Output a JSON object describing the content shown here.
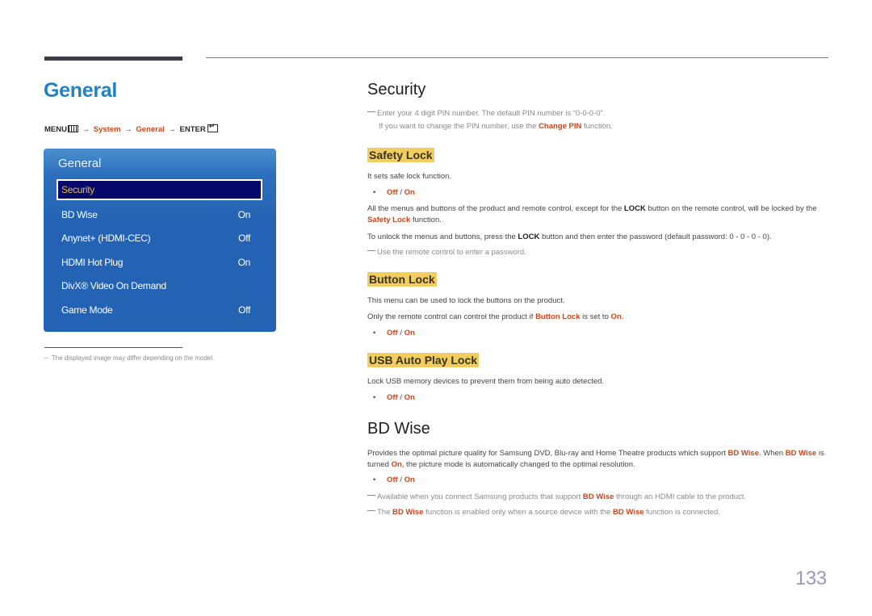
{
  "left": {
    "title": "General",
    "breadcrumb": {
      "menu": "MENU",
      "arrow": "→",
      "system": "System",
      "general": "General",
      "enter": "ENTER"
    },
    "osd": {
      "title": "General",
      "items": [
        {
          "label": "Security",
          "value": "",
          "selected": true
        },
        {
          "label": "BD Wise",
          "value": "On"
        },
        {
          "label": "Anynet+ (HDMI-CEC)",
          "value": "Off"
        },
        {
          "label": "HDMI Hot Plug",
          "value": "On"
        },
        {
          "label": "DivX® Video On Demand",
          "value": ""
        },
        {
          "label": "Game Mode",
          "value": "Off"
        }
      ]
    },
    "footnote": "The displayed image may differ depending on the model."
  },
  "security": {
    "title": "Security",
    "note1": "Enter your 4 digit PIN number. The default PIN number is “0-0-0-0”.",
    "note2_pre": "If you want to change the PIN number, use the ",
    "note2_link": "Change PIN",
    "note2_post": " function."
  },
  "safety_lock": {
    "title": "Safety Lock",
    "desc": "It sets safe lock function.",
    "opt_off": "Off",
    "opt_sep": " / ",
    "opt_on": "On",
    "p1_pre": "All the menus and buttons of the product and remote control, except for the ",
    "p1_lock": "LOCK",
    "p1_mid": " button on the remote control, will be locked by the ",
    "p1_link": "Safety Lock",
    "p1_post": " function.",
    "p2_pre": "To unlock the menus and buttons, press the ",
    "p2_lock": "LOCK",
    "p2_post": " button and then enter the password (default password: 0 - 0 - 0 - 0).",
    "note": "Use the remote control to enter a password."
  },
  "button_lock": {
    "title": "Button Lock",
    "desc": "This menu can be used to lock the buttons on the product.",
    "p_pre": "Only the remote control can control the product if ",
    "p_link": "Button Lock",
    "p_mid": " is set to ",
    "p_on": "On",
    "p_post": ".",
    "opt_off": "Off",
    "opt_sep": " / ",
    "opt_on": "On"
  },
  "usb_lock": {
    "title": "USB Auto Play Lock",
    "desc": "Lock USB memory devices to prevent them from being auto detected.",
    "opt_off": "Off",
    "opt_sep": " / ",
    "opt_on": "On"
  },
  "bd_wise": {
    "title": "BD Wise",
    "p_pre": "Provides the optimal picture quality for Samsung DVD, Blu-ray and Home Theatre products which support ",
    "p_link1": "BD Wise",
    "p_mid": ". When ",
    "p_link2": "BD Wise",
    "p_mid2": " is turned ",
    "p_on": "On",
    "p_post": ", the picture mode is automatically changed to the optimal resolution.",
    "opt_off": "Off",
    "opt_sep": " / ",
    "opt_on": "On",
    "note1_pre": "Available when you connect Samsung products that support ",
    "note1_link": "BD Wise",
    "note1_post": " through an HDMI cable to the product.",
    "note2_pre": "The ",
    "note2_link1": "BD Wise",
    "note2_mid": " function is enabled only when a source device with the ",
    "note2_link2": "BD Wise",
    "note2_post": " function is connected."
  },
  "page_number": "133"
}
